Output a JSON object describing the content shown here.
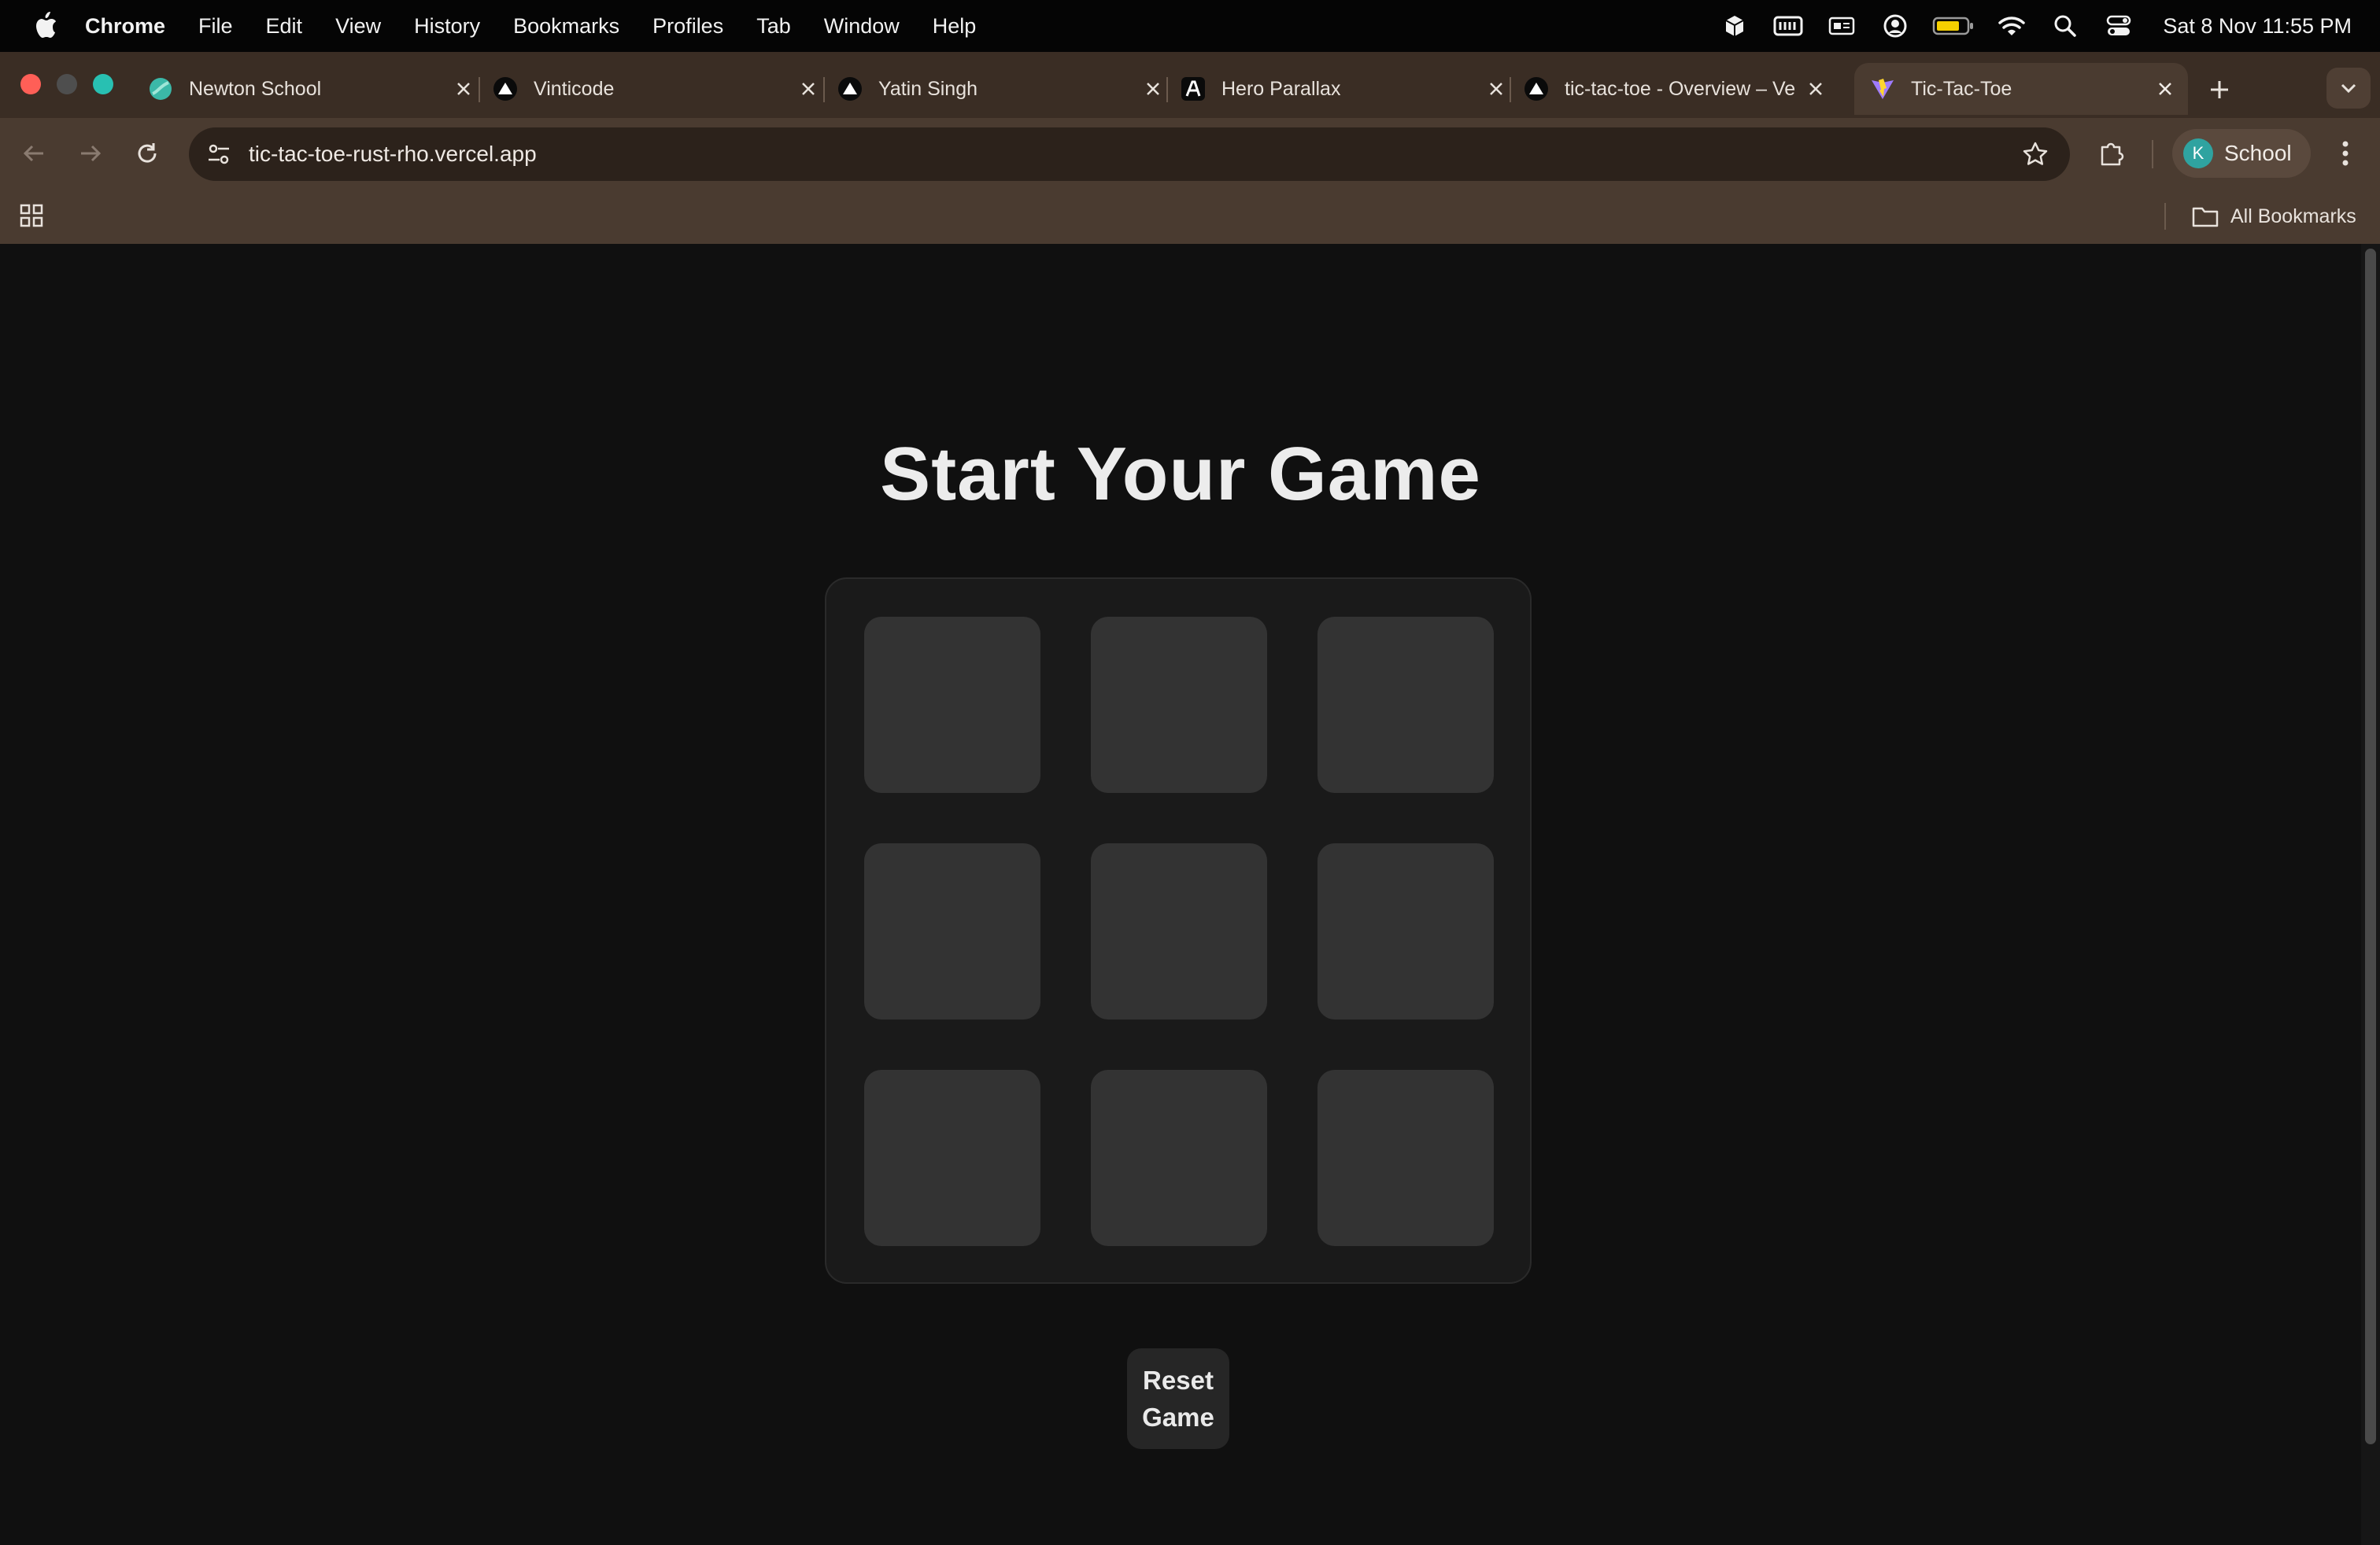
{
  "menubar": {
    "app_name": "Chrome",
    "items": [
      "File",
      "Edit",
      "View",
      "History",
      "Bookmarks",
      "Profiles",
      "Tab",
      "Window",
      "Help"
    ],
    "clock": "Sat 8 Nov  11:55 PM"
  },
  "tabs": [
    {
      "title": "Newton School",
      "favicon": "newton-school-logo-icon"
    },
    {
      "title": "Vinticode",
      "favicon": "vercel-triangle-icon"
    },
    {
      "title": "Yatin Singh",
      "favicon": "vercel-triangle-icon"
    },
    {
      "title": "Hero Parallax",
      "favicon": "aceternity-logo-icon"
    },
    {
      "title": "tic-tac-toe - Overview – Ve",
      "favicon": "vercel-triangle-icon"
    },
    {
      "title": "Tic-Tac-Toe",
      "favicon": "vite-logo-icon",
      "active": true
    }
  ],
  "toolbar": {
    "url": "tic-tac-toe-rust-rho.vercel.app",
    "profile_initial": "K",
    "profile_name": "School"
  },
  "bookmarks": {
    "all_label": "All Bookmarks"
  },
  "game": {
    "title": "Start Your Game",
    "cells": [
      "",
      "",
      "",
      "",
      "",
      "",
      "",
      "",
      ""
    ],
    "reset_line1": "Reset",
    "reset_line2": "Game"
  },
  "colors": {
    "page_bg": "#101010",
    "board_bg": "#1a1a1a",
    "cell_bg": "#333333",
    "chrome_frame": "#4a3b30"
  }
}
